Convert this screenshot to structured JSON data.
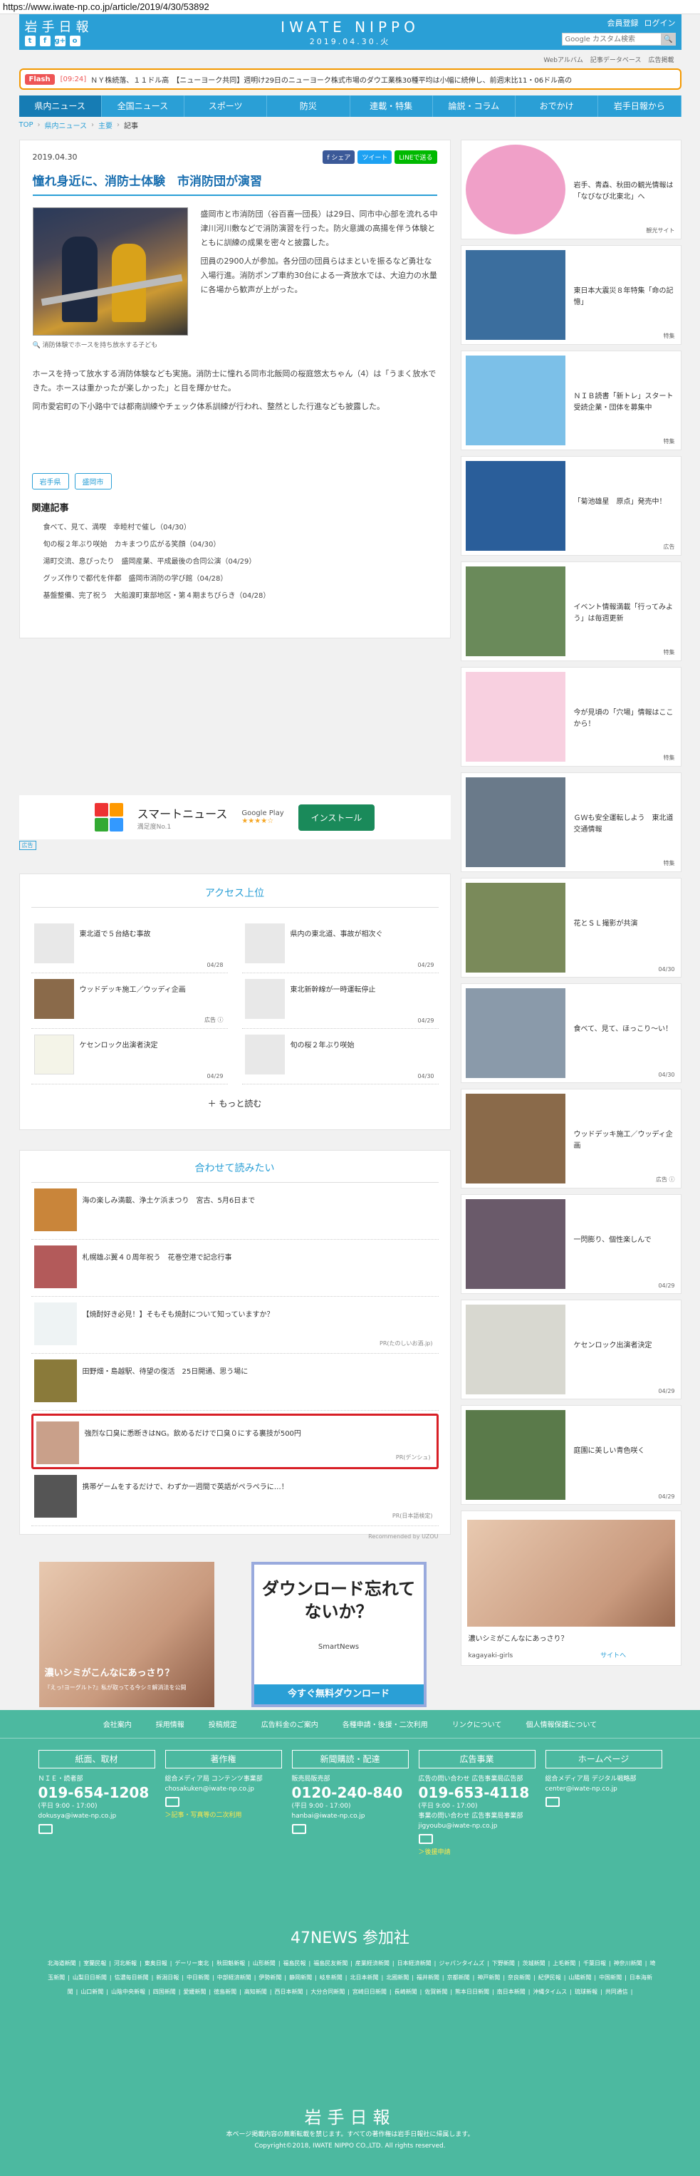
{
  "url": "https://www.iwate-np.co.jp/article/2019/4/30/53892",
  "header": {
    "logo_left": "岩手日報",
    "social": [
      "t",
      "f",
      "g+",
      "o"
    ],
    "logo_center": "IWATE NIPPO",
    "date": "2019.04.30.火",
    "links": [
      "会員登録",
      "ログイン"
    ],
    "search_placeholder": "Google カスタム検索",
    "search_btn": "🔍"
  },
  "subnav": [
    "Webアルバム",
    "記事データベース",
    "広告掲載"
  ],
  "flash": {
    "tag": "Flash",
    "time": "[09:24]",
    "text": "ＮＹ株続落、１１ドル高　【ニューヨーク共同】週明け29日のニューヨーク株式市場のダウ工業株30種平均は小幅に続伸し、前週末比11・06ドル高の"
  },
  "gnav": [
    "県内ニュース",
    "全国ニュース",
    "スポーツ",
    "防災",
    "連載・特集",
    "論説・コラム",
    "おでかけ",
    "岩手日報から"
  ],
  "bread": [
    "TOP",
    "県内ニュース",
    "主要",
    "記事"
  ],
  "article": {
    "date": "2019.04.30",
    "share": [
      "f シェア",
      "ツイート",
      "LINEで送る"
    ],
    "title": "憧れ身近に、消防士体験　市消防団が演習",
    "caption": "消防体験でホースを持ち放水する子ども",
    "p1": "盛岡市と市消防団（谷百喜一団長）は29日、同市中心部を流れる中津川河川敷などで消防演習を行った。防火意識の高揚を伴う体験とともに訓練の成果を密々と披露した。",
    "p2": "団員の2900人が参加。各分団の団員らはまといを振るなど勇壮な入場行進。消防ポンプ車約30台による一斉放水では、大迫力の水量に各場から歓声が上がった。",
    "p3": "ホースを持って放水する消防体験なども実施。消防士に憧れる同市北飯岡の桜庭悠太ちゃん（4）は「うまく放水できた。ホースは重かったが楽しかった」と目を輝かせた。",
    "p4": "同市愛宕町の下小路中では都南訓練やチェック体系訓練が行われ、整然とした行進なども披露した。",
    "tags": [
      "岩手県",
      "盛岡市"
    ],
    "related_title": "関連記事",
    "related": [
      "食べて、見て、満喫　幸睦村で催し（04/30）",
      "旬の桜２年ぶり咲始　カキまつり広がる笑顔（04/30）",
      "湯町交流、息ぴったり　盛岡産業、平成最後の合同公演（04/29）",
      "グッズ作りで都代を伴都　盛岡市消防の学び館（04/28）",
      "基盤整備、完了祝う　大船渡町東部地区・第４期まちびらき（04/28）"
    ]
  },
  "smartnews": {
    "title": "スマートニュース",
    "sub": "満足度No.1",
    "gp": "Google Play",
    "stars": "★★★★☆",
    "install": "インストール",
    "ad": "広告"
  },
  "access": {
    "title": "アクセス上位",
    "items": [
      {
        "t": "東北道で５台絡む事故",
        "d": "04/28"
      },
      {
        "t": "県内の東北道、事故が相次ぐ",
        "d": "04/29"
      },
      {
        "t": "ウッドデッキ施工／ウッディ企画",
        "d": "広告 ⓘ"
      },
      {
        "t": "東北新幹線が一時運転停止",
        "d": "04/29"
      },
      {
        "t": "ケセンロック出演者決定",
        "d": "04/29"
      },
      {
        "t": "旬の桜２年ぶり咲始",
        "d": "04/30"
      }
    ],
    "more": "＋ もっと読む"
  },
  "reco": {
    "title": "合わせて読みたい",
    "items": [
      {
        "t": "海の楽しみ満載、浄土ケ浜まつり　宮古、5月6日まで",
        "pr": ""
      },
      {
        "t": "札幌雄ぶ翼４０周年祝う　花巻空港で記念行事",
        "pr": ""
      },
      {
        "t": "【焼酎好き必見！】そもそも焼酎について知っていますか？",
        "pr": "PR(たのしいお酒.jp)"
      },
      {
        "t": "田野畑・島越駅、待望の復活　25日開通、思う場に",
        "pr": ""
      },
      {
        "t": "強烈な口臭に悉断きはNG。飲めるだけで口臭０にする裏技が500円",
        "pr": "PR(デンシュ)"
      },
      {
        "t": "携帯ゲームをするだけで、わずか一週間で英語がペラペラに…！",
        "pr": "PR(日本語検定)"
      }
    ],
    "by": "Recommended by UZOU"
  },
  "ads": {
    "a_text": "濃いシミがこんなにあっさり？",
    "a_sub": "『えっ!ヨーグルト?』私が取ってる今シミ解消法を公開",
    "b_head": "ダウンロード忘れてないか？",
    "b_sn": "SmartNews",
    "b_foot": "今すぐ無料ダウンロード"
  },
  "side": [
    {
      "t": "岩手、青森、秋田の観光情報は「なびなび北東北」へ",
      "m": "観光サイト",
      "c": "#f0a0c8"
    },
    {
      "t": "東日本大震災８年特集「命の記憶」",
      "m": "特集",
      "c": "#3b6e9e"
    },
    {
      "t": "ＮＩＢ読書「新トレ」スタート　受読企業・団体を募集中",
      "m": "特集",
      "c": "#7cc0e8"
    },
    {
      "t": "「菊池雄星　原点」発売中！",
      "m": "広告",
      "c": "#2a5e9a"
    },
    {
      "t": "イベント情報満載「行ってみよう」は毎週更新",
      "m": "特集",
      "c": "#6a8a5a"
    },
    {
      "t": "今が見頃の「穴場」情報はここから！",
      "m": "特集",
      "c": "#f8d0e0"
    },
    {
      "t": "ＧＷも安全運転しよう　東北道交通情報",
      "m": "特集",
      "c": "#6a7a8a"
    },
    {
      "t": "花とＳＬ撮影が共演",
      "m": "04/30",
      "c": "#7a8a5a"
    },
    {
      "t": "食べて、見て、ほっこり〜い！",
      "m": "04/30",
      "c": "#8a9aaa"
    },
    {
      "t": "ウッドデッキ施工／ウッディ企画",
      "m": "広告 ⓘ",
      "c": "#8a6a4a"
    },
    {
      "t": "一閃膨り、個性楽しんで",
      "m": "04/29",
      "c": "#6a5a6a"
    },
    {
      "t": "ケセンロック出演者決定",
      "m": "04/29",
      "c": "#d8d8d0"
    },
    {
      "t": "庭園に美しい青色咲く",
      "m": "04/29",
      "c": "#5a7a4a"
    }
  ],
  "side_ad": {
    "q": "濃いシミがこんなにあっさり？",
    "src": "kagayaki-girls",
    "link": "サイトへ"
  },
  "footer": {
    "links": [
      "会社案内",
      "採用情報",
      "投稿規定",
      "広告料金のご案内",
      "各種申請・後援・二次利用",
      "リンクについて",
      "個人情報保護について"
    ],
    "cols": [
      {
        "hd": "紙面、取材",
        "l1": "ＮＩＥ・読者部",
        "tel": "019-654-1208",
        "hours": "(平日 9:00 - 17:00)",
        "mail": "dokusya@iwate-np.co.jp",
        "y": ""
      },
      {
        "hd": "著作権",
        "l1": "総合メディア局 コンテンツ事業部",
        "tel": "",
        "hours": "",
        "mail": "chosakuken@iwate-np.co.jp",
        "y": "＞記事・写真等の二次利用"
      },
      {
        "hd": "新聞購読・配達",
        "l1": "販売局販売部",
        "tel": "0120-240-840",
        "hours": "(平日 9:00 - 17:00)",
        "mail": "hanbai@iwate-np.co.jp",
        "y": ""
      },
      {
        "hd": "広告事業",
        "l1": "広告の問い合わせ 広告事業局広告部",
        "tel": "019-653-4118",
        "hours": "(平日 9:00 - 17:00)",
        "mail": "事業の問い合わせ 広告事業局事業部 jigyoubu@iwate-np.co.jp",
        "y": "＞後援申請"
      },
      {
        "hd": "ホームページ",
        "l1": "総合メディア局 デジタル戦略部",
        "tel": "",
        "hours": "",
        "mail": "center@iwate-np.co.jp",
        "y": ""
      }
    ],
    "f47": "47NEWS 参加社",
    "papers": [
      "北海道新聞",
      "室蘭民報",
      "河北新報",
      "東奥日報",
      "デーリー東北",
      "秋田魁新報",
      "山形新聞",
      "福島民報",
      "福島民友新聞",
      "産業経済新聞",
      "日本経済新聞",
      "ジャパンタイムズ",
      "下野新聞",
      "茨城新聞",
      "上毛新聞",
      "千葉日報",
      "神奈川新聞",
      "埼玉新聞",
      "山梨日日新聞",
      "信濃毎日新聞",
      "新潟日報",
      "中日新聞",
      "中部経済新聞",
      "伊勢新聞",
      "静岡新聞",
      "岐阜新聞",
      "北日本新聞",
      "北國新聞",
      "福井新聞",
      "京都新聞",
      "神戸新聞",
      "奈良新聞",
      "紀伊民報",
      "山陽新聞",
      "中国新聞",
      "日本海新聞",
      "山口新聞",
      "山陰中央新報",
      "四国新聞",
      "愛媛新聞",
      "徳島新聞",
      "高知新聞",
      "西日本新聞",
      "大分合同新聞",
      "宮崎日日新聞",
      "長崎新聞",
      "佐賀新聞",
      "熊本日日新聞",
      "南日本新聞",
      "沖縄タイムス",
      "琉球新報",
      "共同通信"
    ],
    "logo": "岩手日報",
    "copy1": "本ページ掲載内容の無断転載を禁じます。すべての著作権は岩手日報社に帰属します。",
    "copy2": "Copyright©2018, IWATE NIPPO CO.,LTD. All rights reserved."
  }
}
